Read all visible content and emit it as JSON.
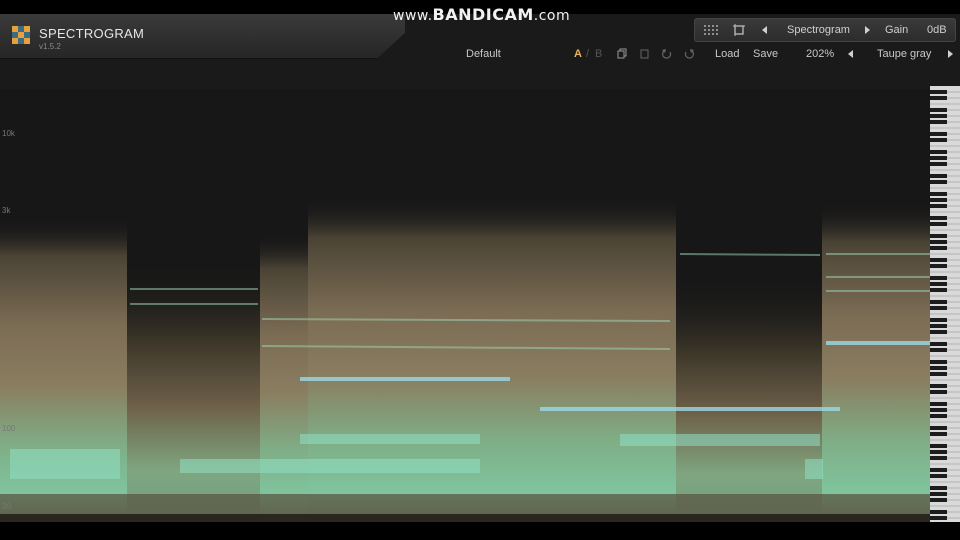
{
  "watermark": {
    "prefix": "www.",
    "brand": "BANDICAM",
    "suffix": ".com"
  },
  "app": {
    "title": "SPECTROGRAM",
    "version": "v1.5.2"
  },
  "header": {
    "view_mode": "Spectrogram",
    "gain_label": "Gain",
    "gain_value": "0dB",
    "preset": "Default",
    "ab_a": "A",
    "ab_sep": "/",
    "ab_b": "B",
    "load": "Load",
    "save": "Save",
    "zoom": "202%",
    "color_scheme": "Taupe gray"
  },
  "axis": {
    "ticks": [
      "10k",
      "3k",
      "100",
      "30"
    ]
  },
  "colors": {
    "accent": "#e7b65a",
    "panel": "#1a1a1a",
    "spectrum_low": "#7fc6a0",
    "spectrum_mid": "#8c7a5c",
    "highlight": "#9ad8e6"
  }
}
